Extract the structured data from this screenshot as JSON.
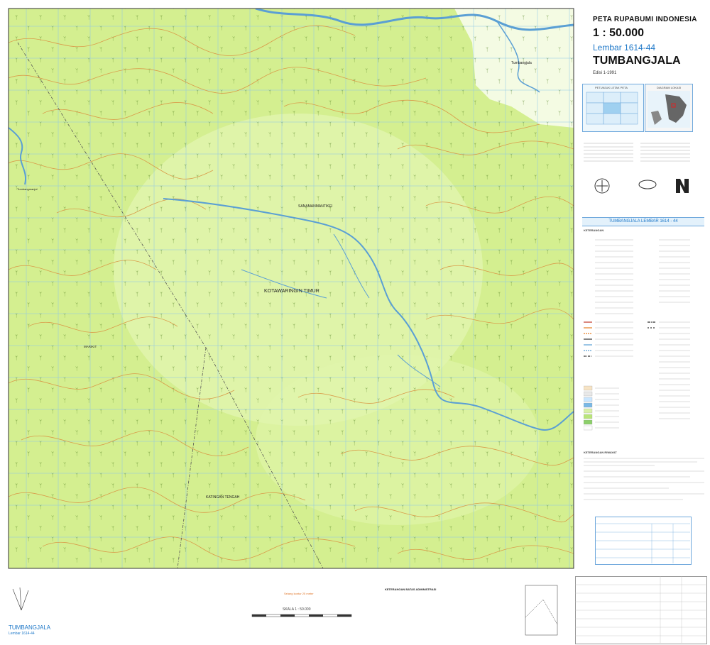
{
  "header": {
    "series": "PETA RUPABUMI INDONESIA",
    "scale": "1 : 50.000",
    "sheet": "Lembar 1614-44",
    "name": "TUMBANGJALA",
    "edition": "Edisi 1-1991"
  },
  "index_panel": {
    "left_title": "PETUNJUK LETAK PETA",
    "right_title": "DIAGRAM LOKASI"
  },
  "sheet_strip": "TUMBANGJALA    LEMBAR 1614 - 44",
  "legend": {
    "title": "KETERANGAN",
    "swatches": [
      "#f6e3c4",
      "#e8e8e8",
      "#c9e6ff",
      "#7ab8e6",
      "#d9f0a8",
      "#b9e57a",
      "#8ccf6a",
      "#fdfdfd"
    ]
  },
  "map": {
    "places": [
      {
        "label": "Tumbangjala"
      },
      {
        "label": "Tumbangmanjul"
      },
      {
        "label": "SANAMANMANTIKEI"
      },
      {
        "label": "KOTAWARINGIN TIMUR"
      },
      {
        "label": "MARIKIT"
      },
      {
        "label": "KATINGAN TENGAH"
      }
    ],
    "colors": {
      "forest": "#d7f09a",
      "forest_light": "#eaf8c6",
      "contour": "#d99c4a",
      "river": "#5a9fd4",
      "grid": "#8ec6e8",
      "boundary": "#555555"
    }
  },
  "bottom": {
    "sheet_name": "TUMBANGJALA",
    "sheet_number": "Lembar 1614-44",
    "scale_label": "SKALA 1 : 50.000",
    "admin_title": "KETERANGAN BATAS ADMINISTRASI",
    "contour_note": "Selang kontur 25 meter"
  },
  "notes": {
    "keterangan_title": "KETERANGAN RIWAYAT"
  }
}
